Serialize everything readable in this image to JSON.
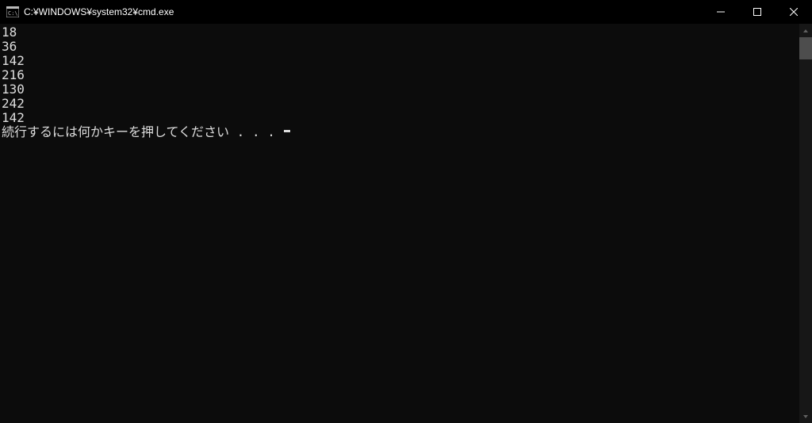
{
  "window": {
    "title": "C:¥WINDOWS¥system32¥cmd.exe"
  },
  "console": {
    "lines": [
      "18",
      "36",
      "142",
      "216",
      "130",
      "242",
      "142"
    ],
    "prompt": "続行するには何かキーを押してください . . . "
  }
}
